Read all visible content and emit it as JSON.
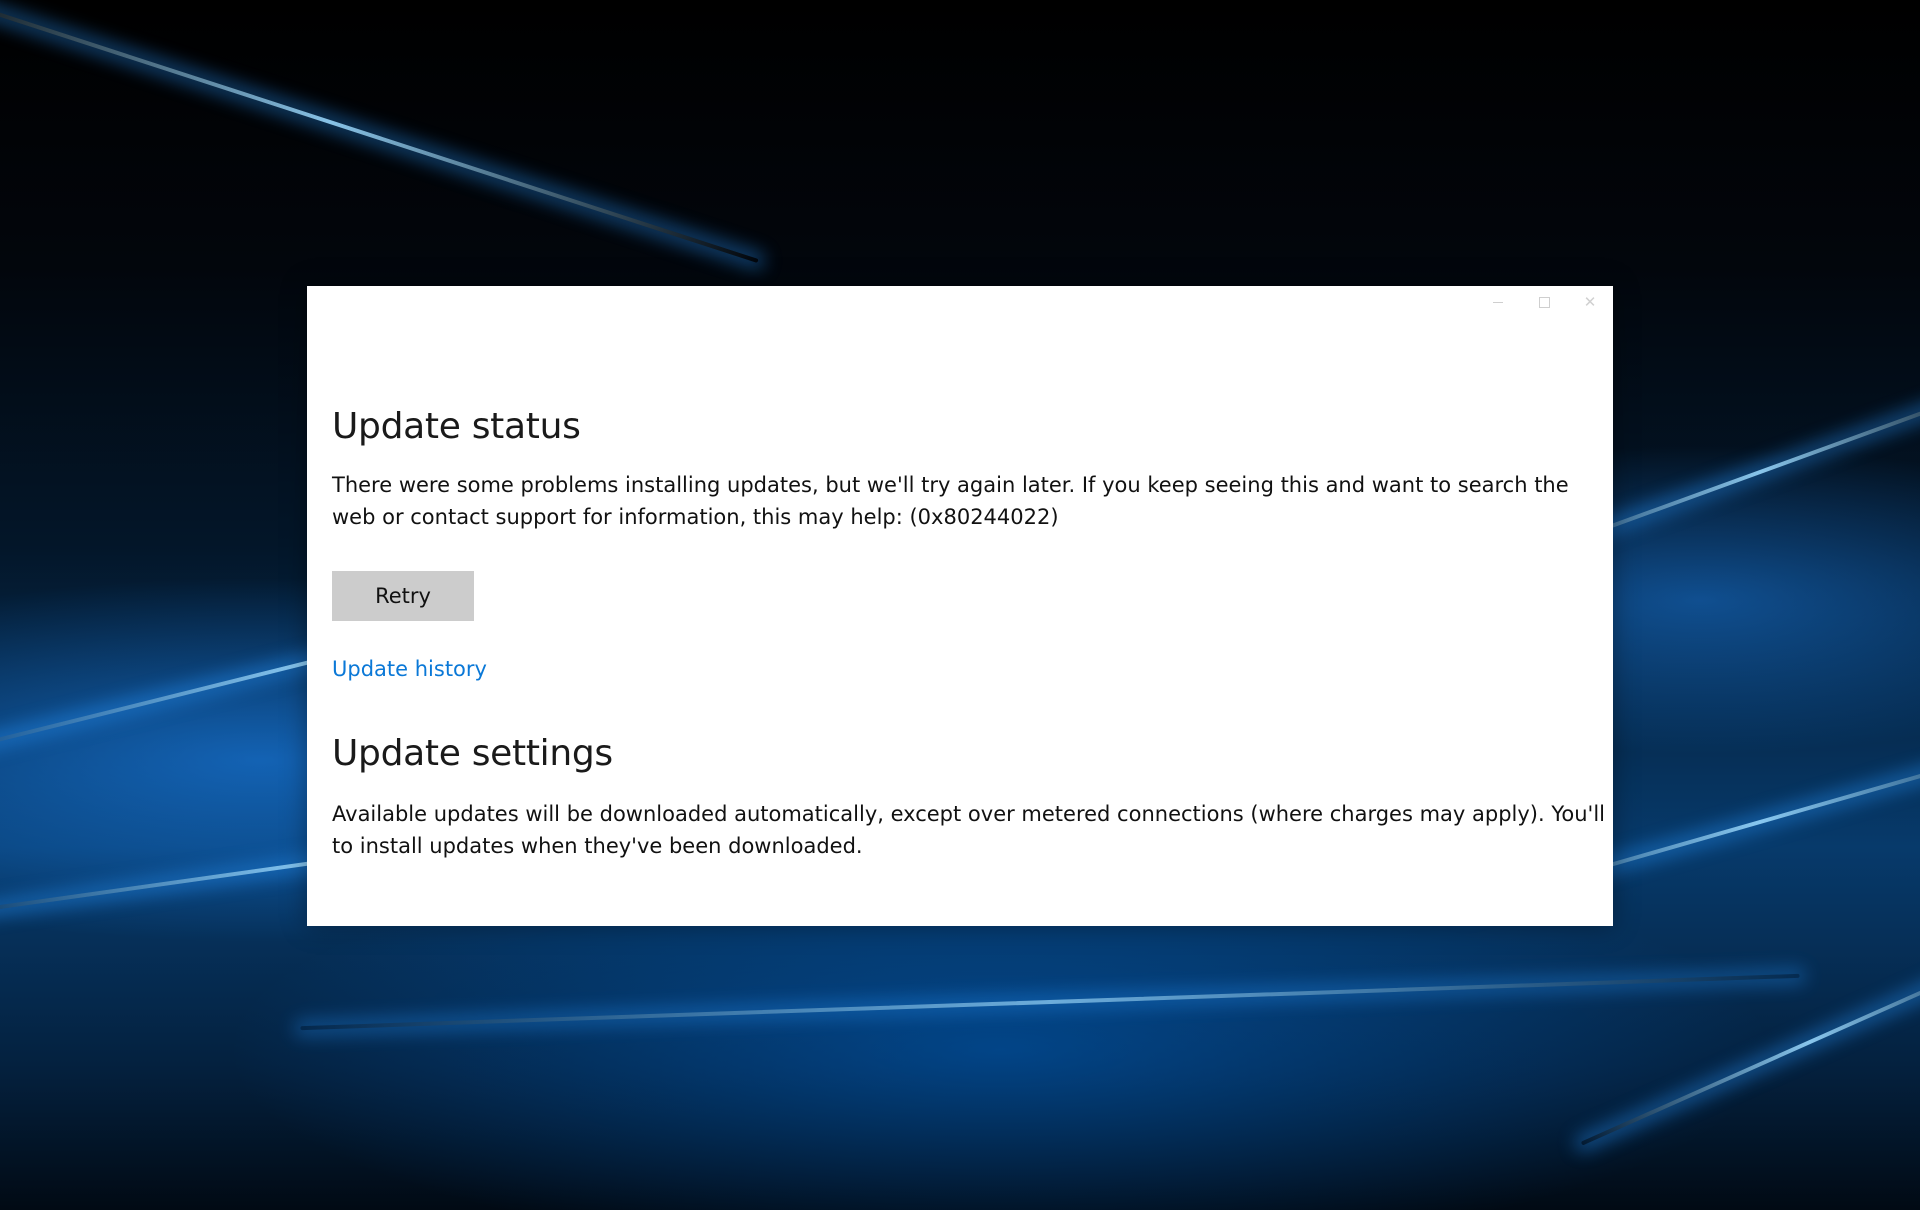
{
  "window": {
    "controls": {
      "minimize_icon": "minimize-icon",
      "maximize_icon": "maximize-icon",
      "close_icon": "close-icon",
      "close_glyph": "✕"
    }
  },
  "update_status": {
    "heading": "Update status",
    "message": "There were some problems installing updates, but we'll try again later. If you keep seeing this and want to search the web or contact support for information, this may help: (0x80244022)",
    "retry_label": "Retry",
    "history_link": "Update history"
  },
  "update_settings": {
    "heading": "Update settings",
    "message": "Available updates will be downloaded automatically, except over metered connections (where charges may apply). You'll be asked to install updates when they've been downloaded."
  },
  "colors": {
    "link": "#0a78d7",
    "button_bg": "#cccccc",
    "window_bg": "#ffffff"
  }
}
